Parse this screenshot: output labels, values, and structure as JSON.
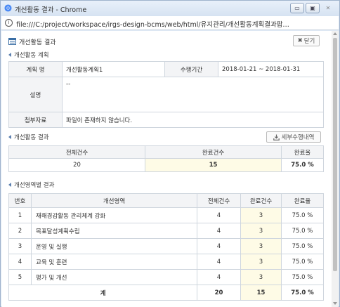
{
  "window": {
    "title": "개선활동 결과 - Chrome",
    "url": "file:///C:/project/workspace/irgs-design-bcms/web/html/유지관리/개선활동계획결과팝…",
    "buttons": {
      "minimize": "▭",
      "maximize": "▣",
      "close": "✕"
    }
  },
  "page": {
    "title": "개선활동 결과",
    "close_button": "닫기",
    "close_icon": "✖"
  },
  "plan": {
    "section_title": "개선활동 계획",
    "name_label": "계획 명",
    "name_value": "개선활동계획1",
    "period_label": "수행기간",
    "period_value": "2018-01-21 ~ 2018-01-31",
    "desc_label": "설명",
    "desc_value": "--",
    "attach_label": "첨부자료",
    "attach_value": "파일이 존재하지 않습니다."
  },
  "result": {
    "section_title": "개선활동 결과",
    "detail_button": "세부수행내역",
    "headers": [
      "전체건수",
      "완료건수",
      "완료율"
    ],
    "row": [
      "20",
      "15",
      "75.0 %"
    ]
  },
  "areas": {
    "section_title": "개선영역별 결과",
    "headers": [
      "번호",
      "개선영역",
      "전체건수",
      "완료건수",
      "완료율"
    ],
    "rows": [
      [
        "1",
        "재해경감활동 관리체계 강화",
        "4",
        "3",
        "75.0 %"
      ],
      [
        "2",
        "목표달성계획수립",
        "4",
        "3",
        "75.0 %"
      ],
      [
        "3",
        "운영 및 실행",
        "4",
        "3",
        "75.0 %"
      ],
      [
        "4",
        "교육 및 훈련",
        "4",
        "3",
        "75.0 %"
      ],
      [
        "5",
        "평가 및 개선",
        "4",
        "3",
        "75.0 %"
      ]
    ],
    "total": [
      "계",
      "20",
      "15",
      "75.0 %"
    ]
  },
  "colors": {
    "accent": "#5b7fae",
    "highlight": "#fefbe6",
    "header_bg": "#f3f4f6"
  }
}
